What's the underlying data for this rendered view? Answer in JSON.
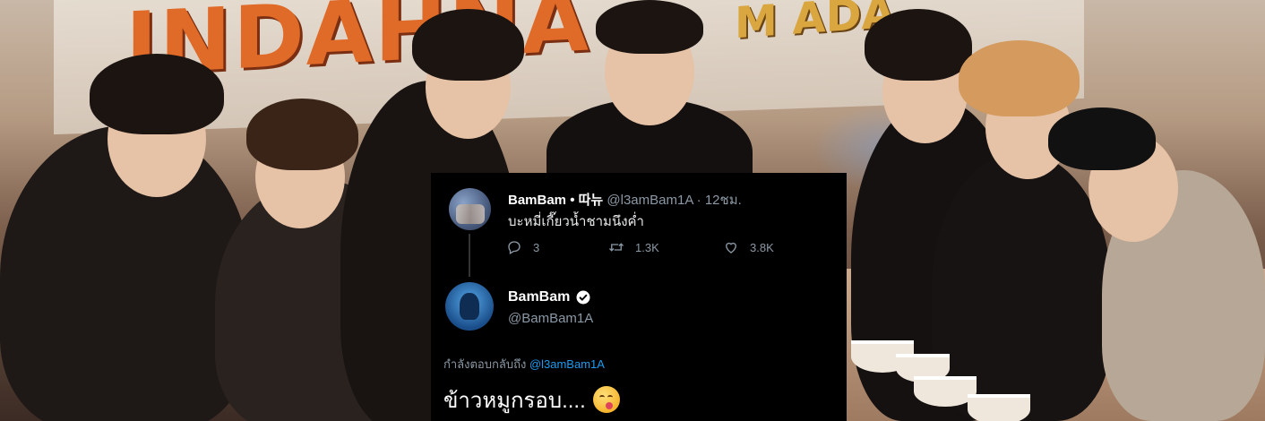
{
  "quoted_tweet": {
    "display_name": "BamBam • 따뉴",
    "handle": "@l3amBam1A",
    "separator": "·",
    "time": "12ชม.",
    "text": "บะหมี่เกี๊ยวน้ำชามนึงค่ำ",
    "reply_count": "3",
    "retweet_count": "1.3K",
    "like_count": "3.8K"
  },
  "reply_tweet": {
    "display_name": "BamBam",
    "handle": "@BamBam1A",
    "replying_to_label": "กำลังตอบกลับถึง",
    "replying_to_handle": "@l3amBam1A",
    "text": "ข้าวหมูกรอบ...."
  },
  "background": {
    "banner_text": "INDAHNA",
    "banner_text_secondary": "M ADA"
  },
  "colors": {
    "tweet_bg": "#000000",
    "link_blue": "#1d9bf0",
    "muted": "#8b98a5",
    "verified": "#1d9bf0"
  },
  "icons": [
    "reply-icon",
    "retweet-icon",
    "like-icon",
    "verified-badge-icon",
    "face-savoring-food-emoji"
  ]
}
